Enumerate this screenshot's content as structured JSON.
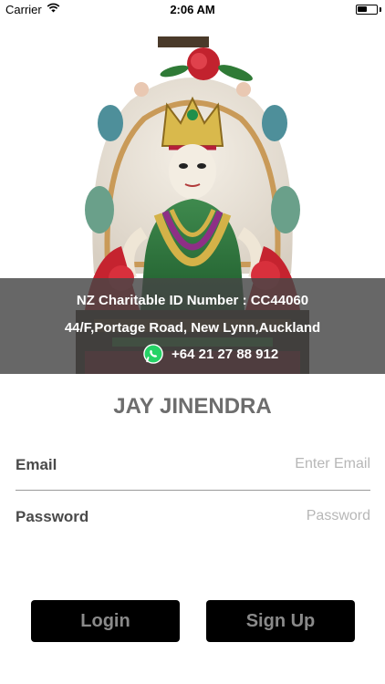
{
  "status_bar": {
    "carrier": "Carrier",
    "time": "2:06 AM",
    "wifi_icon": "wifi-icon",
    "battery_icon": "battery-icon",
    "battery_level": 0.5
  },
  "hero": {
    "image": "deity-statue-image"
  },
  "info": {
    "charity_line": "NZ Charitable ID Number : CC44060",
    "address_line": "44/F,Portage Road, New Lynn,Auckland",
    "phone": "+64 21 27 88 912",
    "phone_icon": "whatsapp-icon",
    "whatsapp_color": "#25d366"
  },
  "app": {
    "title": "JAY JINENDRA"
  },
  "form": {
    "email_label": "Email",
    "email_placeholder": "Enter Email",
    "email_value": "",
    "password_label": "Password",
    "password_placeholder": "Password",
    "password_value": ""
  },
  "buttons": {
    "login": "Login",
    "signup": "Sign Up",
    "background": "#000000",
    "text_color": "#8a8a8a"
  }
}
